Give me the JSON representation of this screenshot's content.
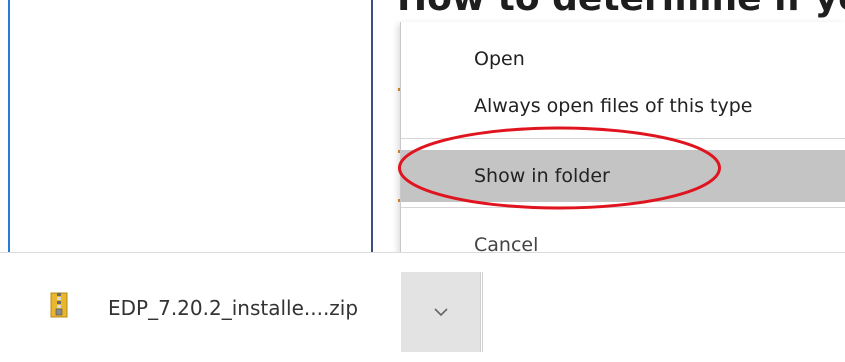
{
  "page": {
    "heading_fragment": "How to determine if you are"
  },
  "context_menu": {
    "items": [
      {
        "label": "Open"
      },
      {
        "label": "Always open files of this type"
      },
      {
        "label": "Show in folder",
        "highlighted": true
      },
      {
        "label": "Cancel"
      }
    ]
  },
  "download_shelf": {
    "file_name": "EDP_7.20.2_installe....zip",
    "file_icon": "zip-archive-icon",
    "menu_icon": "chevron-down-icon"
  },
  "colors": {
    "highlight_ring": "#e0141e",
    "hover_bg": "#c4c4c4",
    "left_edge": "#2b7bd6"
  }
}
